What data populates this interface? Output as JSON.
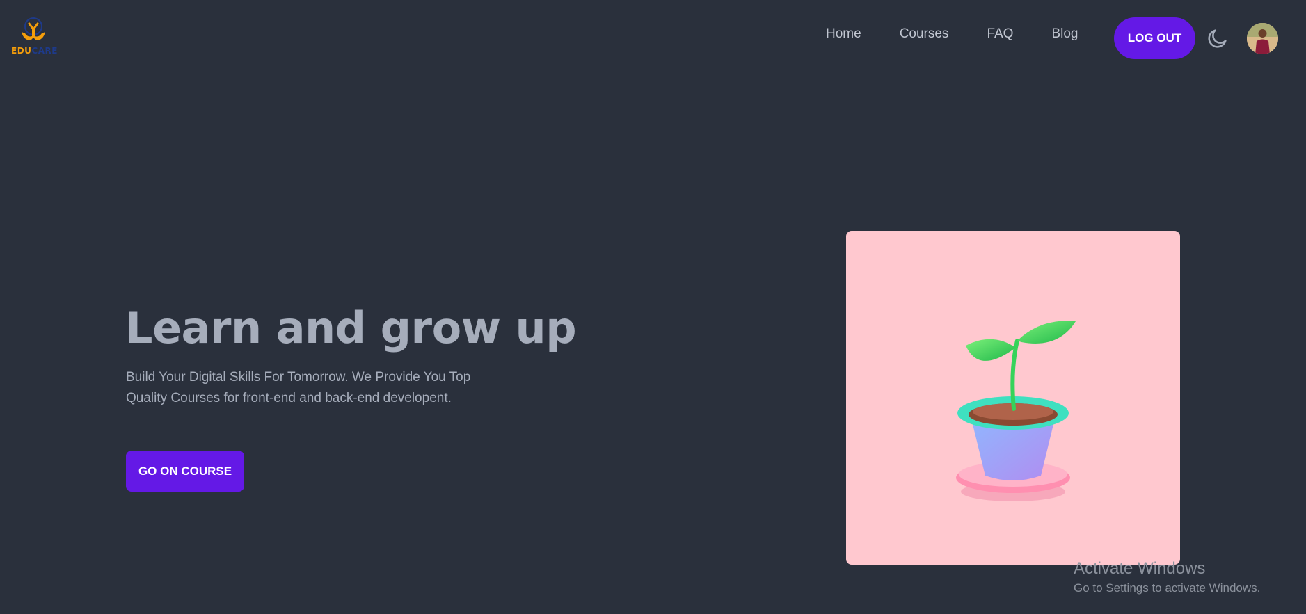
{
  "brand": {
    "name_part1": "EDU",
    "name_part2": "CARE"
  },
  "nav": {
    "links": [
      {
        "label": "Home"
      },
      {
        "label": "Courses"
      },
      {
        "label": "FAQ"
      },
      {
        "label": "Blog"
      }
    ],
    "logout_label": "LOG OUT",
    "theme_icon": "moon-icon",
    "avatar_icon": "user-avatar"
  },
  "hero": {
    "title": "Learn and grow up",
    "description": "Build Your Digital Skills For Tomorrow. We Provide You Top Quality Courses for front-end and back-end developent.",
    "cta_label": "GO ON COURSE",
    "image_icon": "potted-sprout-illustration"
  },
  "watermark": {
    "title": "Activate Windows",
    "subtitle": "Go to Settings to activate Windows."
  },
  "colors": {
    "background": "#2a303c",
    "primary": "#6419e6",
    "text_muted": "#a6adbb",
    "image_bg": "#ffc8cf"
  }
}
